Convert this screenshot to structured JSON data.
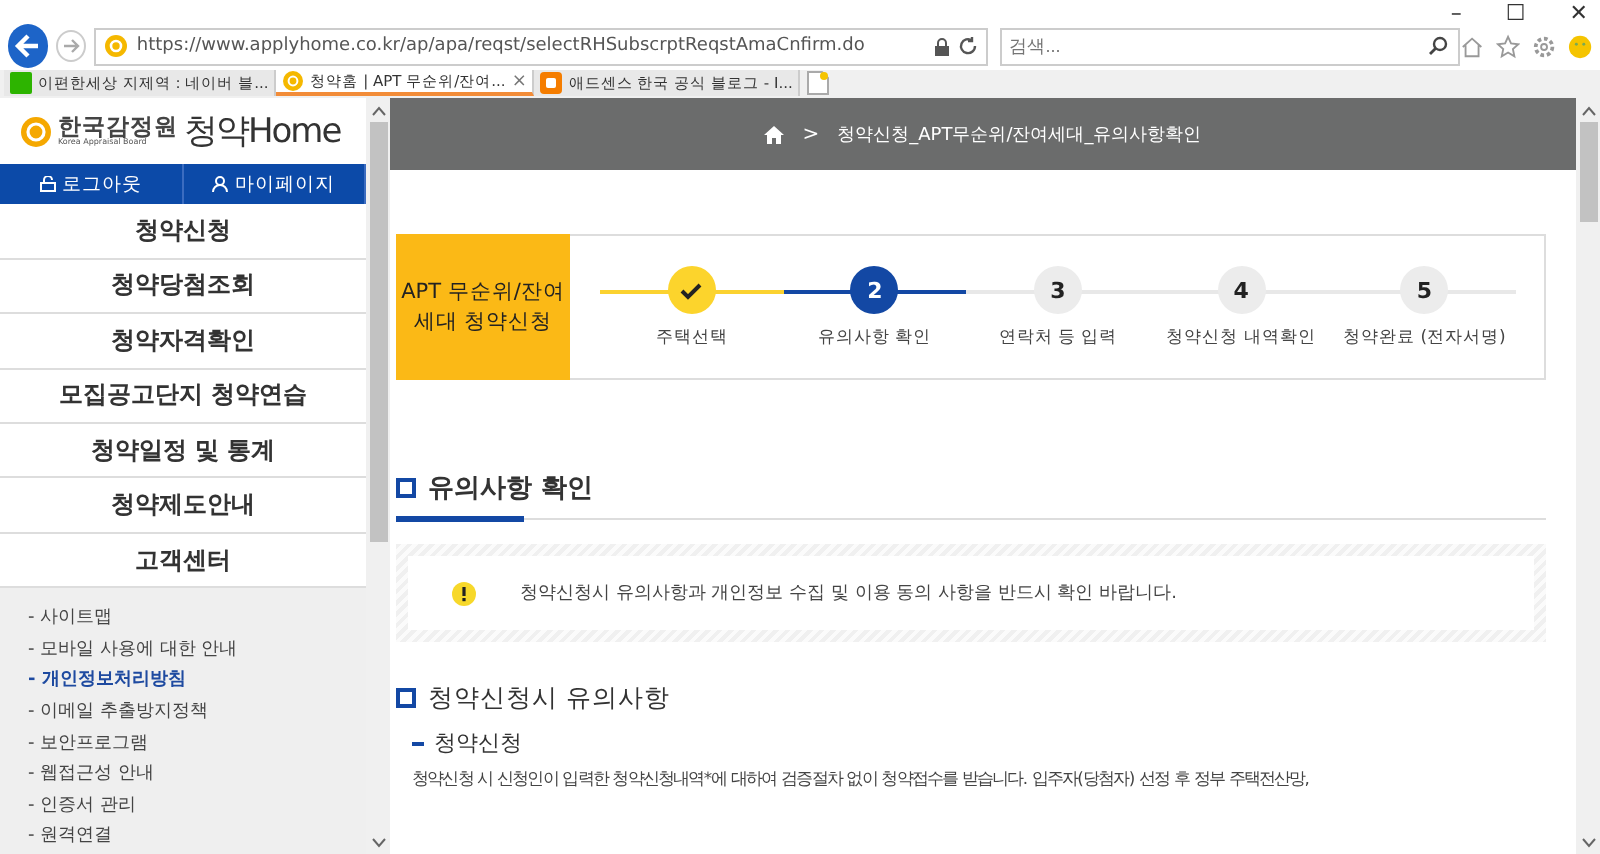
{
  "browser": {
    "url": "https://www.applyhome.co.kr/ap/apa/reqst/selectRHSubscrptReqstAmaCnfirm.do",
    "search": {
      "placeholder": "검색..."
    },
    "window_controls": [
      "–",
      "☐",
      "✕"
    ],
    "tabs": [
      {
        "label": "이편한세상 지제역 : 네이버 블...",
        "selected": false
      },
      {
        "label": "청약홈 | APT 무순위/잔여...",
        "selected": true,
        "close": "×"
      },
      {
        "label": "애드센스 한국 공식 블로그 - I...",
        "selected": false
      }
    ]
  },
  "sidebar": {
    "logo": {
      "org": "한국감정원",
      "org_en": "Korea Appraisal Board",
      "brand": "청약Home"
    },
    "account_buttons": [
      "로그아웃",
      "마이페이지"
    ],
    "menu": [
      "청약신청",
      "청약당첨조회",
      "청약자격확인",
      "모집공고단지 청약연습",
      "청약일정 및 통계",
      "청약제도안내",
      "고객센터"
    ],
    "links": [
      {
        "label": "- 사이트맵",
        "selected": false
      },
      {
        "label": "- 모바일 사용에 대한 안내",
        "selected": false
      },
      {
        "label": "- 개인정보처리방침",
        "selected": true
      },
      {
        "label": "- 이메일 추출방지정책",
        "selected": false
      },
      {
        "label": "- 보안프로그램",
        "selected": false
      },
      {
        "label": "- 웹접근성 안내",
        "selected": false
      },
      {
        "label": "- 인증서 관리",
        "selected": false
      },
      {
        "label": "- 원격연결",
        "selected": false
      }
    ]
  },
  "breadcrumb": {
    "separator": ">",
    "current": "청약신청_APT무순위/잔여세대_유의사항확인"
  },
  "stepper": {
    "title": "APT 무순위/잔여세대 청약신청",
    "steps": [
      {
        "label": "주택선택",
        "completed": true,
        "selected": false
      },
      {
        "number": "2",
        "label": "유의사항 확인",
        "completed": false,
        "selected": true
      },
      {
        "number": "3",
        "label": "연락처 등 입력",
        "completed": false,
        "selected": false
      },
      {
        "number": "4",
        "label": "청약신청 내역확인",
        "completed": false,
        "selected": false
      },
      {
        "number": "5",
        "label": "청약완료 (전자서명)",
        "completed": false,
        "selected": false
      }
    ]
  },
  "section_title": "유의사항 확인",
  "notice": "청약신청시 유의사항과 개인정보 수집 및 이용 동의 사항을 반드시 확인 바랍니다.",
  "section2_title": "청약신청시 유의사항",
  "subsection_title": "청약신청",
  "paragraph": "청약신청 시 신청인이 입력한 청약신청내역*에 대하여 검증절차 없이 청약접수를 받습니다. 입주자(당첨자) 선정 후 정부 주택전산망,"
}
